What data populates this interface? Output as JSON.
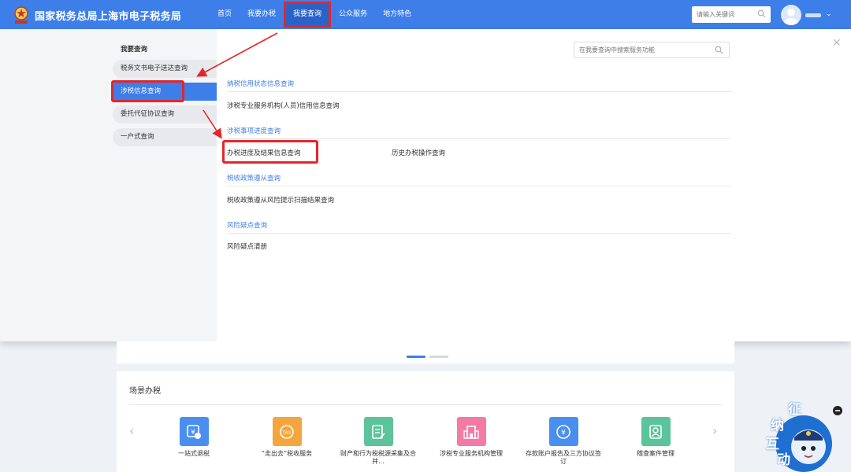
{
  "header": {
    "site_title": "国家税务总局上海市电子税务局",
    "nav": [
      "首页",
      "我要办税",
      "我要查询",
      "公众服务",
      "地方特色"
    ],
    "active_nav": "我要查询",
    "search_placeholder": "请输入关键词",
    "colors": {
      "bar": "#3d7ee9",
      "highlight": "#e4262a"
    }
  },
  "panel": {
    "side_title": "我要查询",
    "side_items": [
      "税务文书电子送达查询",
      "涉税信息查询",
      "委托代征协议查询",
      "一户式查询"
    ],
    "active_side_item": "涉税信息查询",
    "search_placeholder": "在我要查询中搜索服务功能",
    "sections": [
      {
        "title": "纳税信用状态信息查询",
        "links": [
          "涉税专业服务机构(人员)信用信息查询"
        ]
      },
      {
        "title": "涉税事项进度查询",
        "links": [
          "办税进度及结果信息查询",
          "历史办税操作查询"
        ]
      },
      {
        "title": "税收政策遵从查询",
        "links": [
          "税收政策遵从风险提示扫描结果查询"
        ]
      },
      {
        "title": "风险疑点查询",
        "links": [
          "风险疑点清册"
        ]
      }
    ]
  },
  "scene": {
    "title": "场景办税",
    "services": [
      {
        "label": "一站式退税",
        "icon": "refund-icon",
        "color": "#4a8ff0"
      },
      {
        "label": "“走出去”税收服务",
        "icon": "tax-globe-icon",
        "color": "#f5a53d"
      },
      {
        "label": "财产和行为税税源采集及合并...",
        "icon": "property-tax-icon",
        "color": "#5cc49a"
      },
      {
        "label": "涉税专业服务机构管理",
        "icon": "building-icon",
        "color": "#f47aa6"
      },
      {
        "label": "存款账户报告及三方协议签订",
        "icon": "deposit-icon",
        "color": "#4a8ff0"
      },
      {
        "label": "稽查案件管理",
        "icon": "inspection-icon",
        "color": "#5cc49a"
      }
    ]
  },
  "mascot": {
    "chars": [
      "纳",
      "征",
      "互",
      "动"
    ]
  }
}
